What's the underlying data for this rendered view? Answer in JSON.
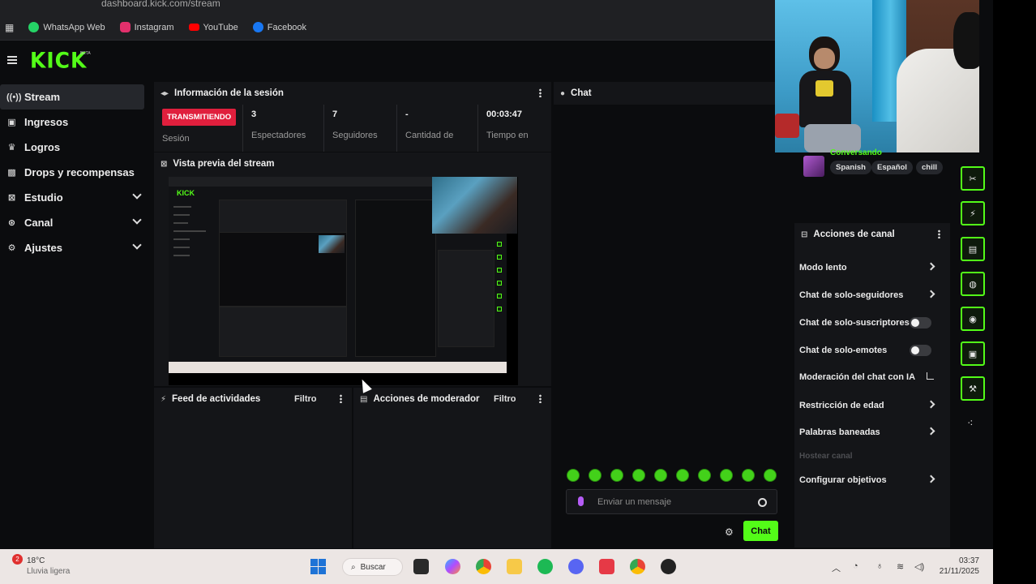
{
  "browser": {
    "url": "dashboard.kick.com/stream",
    "bookmarks": [
      {
        "label": "WhatsApp Web",
        "icon": "whatsapp-icon",
        "color": "#25d366"
      },
      {
        "label": "Instagram",
        "icon": "instagram-icon",
        "color": "#e1306c"
      },
      {
        "label": "YouTube",
        "icon": "youtube-icon",
        "color": "#ff0000"
      },
      {
        "label": "Facebook",
        "icon": "facebook-icon",
        "color": "#1877f2"
      }
    ]
  },
  "header": {
    "logo": "KICK",
    "logo_badge": "BETA"
  },
  "sidebar": {
    "items": [
      {
        "label": "Stream",
        "icon": "broadcast-icon"
      },
      {
        "label": "Ingresos",
        "icon": "wallet-icon"
      },
      {
        "label": "Logros",
        "icon": "trophy-icon"
      },
      {
        "label": "Drops y recompensas",
        "icon": "gift-icon"
      },
      {
        "label": "Estudio",
        "icon": "studio-icon"
      },
      {
        "label": "Canal",
        "icon": "channel-icon"
      },
      {
        "label": "Ajustes",
        "icon": "gear-icon"
      }
    ]
  },
  "session": {
    "title": "Información de la sesión",
    "status": "TRANSMITIENDO",
    "status_label": "Sesión",
    "stats": [
      {
        "value": "3",
        "label": "Espectadores"
      },
      {
        "value": "7",
        "label": "Seguidores"
      },
      {
        "value": "-",
        "label": "Cantidad de"
      },
      {
        "value": "00:03:47",
        "label": "Tiempo en"
      }
    ]
  },
  "preview": {
    "title": "Vista previa del stream"
  },
  "feed": {
    "title": "Feed de actividades",
    "filter": "Filtro"
  },
  "mod_actions": {
    "title": "Acciones de moderador",
    "filter": "Filtro"
  },
  "chat": {
    "title": "Chat",
    "placeholder": "Enviar un mensaje",
    "send_label": "Chat",
    "accent": "#53fc18"
  },
  "stream_info": {
    "category": "Conversando",
    "tags": [
      "Spanish",
      "Español",
      "chill"
    ]
  },
  "channel_actions": {
    "title": "Acciones de canal",
    "items": [
      {
        "label": "Modo lento",
        "control": "chevron"
      },
      {
        "label": "Chat de solo-seguidores",
        "control": "chevron"
      },
      {
        "label": "Chat de solo-suscriptores",
        "control": "toggle"
      },
      {
        "label": "Chat de solo-emotes",
        "control": "toggle"
      },
      {
        "label": "Moderación del chat con IA",
        "control": "external"
      },
      {
        "label": "Restricción de edad",
        "control": "chevron"
      },
      {
        "label": "Palabras baneadas",
        "control": "chevron"
      },
      {
        "label": "Hostear canal",
        "control": "none",
        "disabled": true
      },
      {
        "label": "Configurar objetivos",
        "control": "chevron"
      }
    ]
  },
  "tool_rail": [
    {
      "icon": "clip-icon",
      "glyph": "✂"
    },
    {
      "icon": "lightning-icon",
      "glyph": "⚡"
    },
    {
      "icon": "note-icon",
      "glyph": "▤"
    },
    {
      "icon": "chat-bubble-icon",
      "glyph": "◍"
    },
    {
      "icon": "broadcast-icon",
      "glyph": "◉"
    },
    {
      "icon": "camera-icon",
      "glyph": "▣"
    },
    {
      "icon": "wrench-icon",
      "glyph": "⚒"
    },
    {
      "icon": "share-icon",
      "glyph": "⁖"
    }
  ],
  "taskbar": {
    "weather_temp": "18°C",
    "weather_desc": "Lluvia ligera",
    "search_label": "Buscar",
    "time": "03:37",
    "date": "21/11/2025"
  }
}
